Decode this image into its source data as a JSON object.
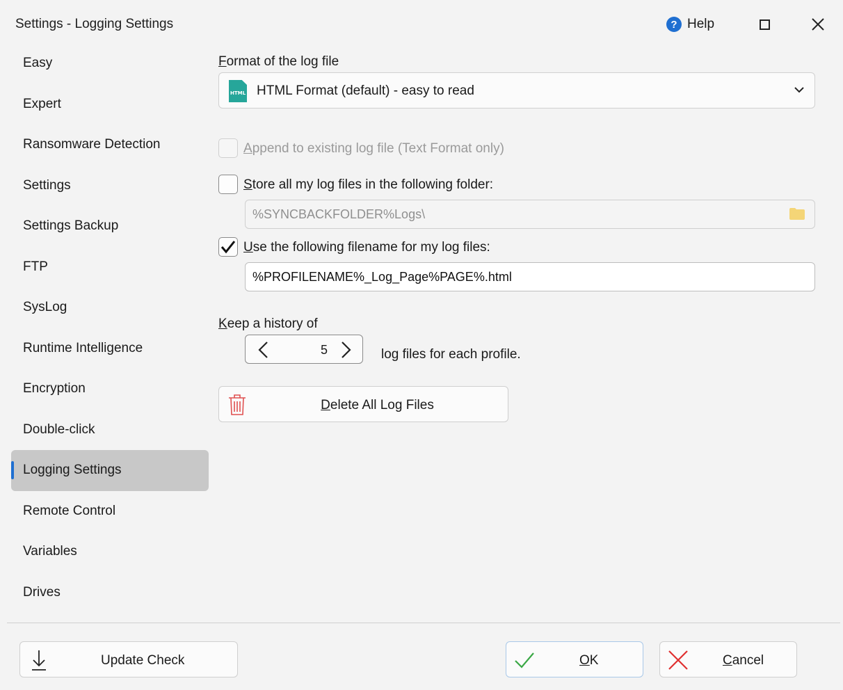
{
  "window": {
    "title": "Settings - Logging Settings",
    "help_label": "Help"
  },
  "sidebar": {
    "items": [
      {
        "label": "Easy"
      },
      {
        "label": "Expert"
      },
      {
        "label": "Ransomware Detection"
      },
      {
        "label": "Settings"
      },
      {
        "label": "Settings Backup"
      },
      {
        "label": "FTP"
      },
      {
        "label": "SysLog"
      },
      {
        "label": "Runtime Intelligence"
      },
      {
        "label": "Encryption"
      },
      {
        "label": "Double-click"
      },
      {
        "label": "Logging Settings",
        "active": true
      },
      {
        "label": "Remote Control"
      },
      {
        "label": "Variables"
      },
      {
        "label": "Drives"
      }
    ]
  },
  "logging": {
    "format_label_first": "F",
    "format_label_rest": "ormat of the log file",
    "format_value": "HTML Format (default) - easy to read",
    "format_icon_text": "HTML",
    "append": {
      "checked": false,
      "disabled": true,
      "label_first": "A",
      "label_rest": "ppend to existing log file (Text Format only)"
    },
    "store_folder": {
      "checked": false,
      "label_first": "S",
      "label_rest": "tore all my log files in the following folder:",
      "value": "%SYNCBACKFOLDER%Logs\\"
    },
    "filename": {
      "checked": true,
      "label_first": "U",
      "label_rest": "se the following filename for my log files:",
      "value": "%PROFILENAME%_Log_Page%PAGE%.html"
    },
    "history": {
      "label_first": "K",
      "label_rest": "eep a history of",
      "value": "5",
      "suffix": "log files for each profile."
    },
    "delete_button": {
      "label_first": "D",
      "label_rest": "elete All Log Files"
    }
  },
  "footer": {
    "update_label": "Update Check",
    "ok_first": "O",
    "ok_rest": "K",
    "cancel_first": "C",
    "cancel_rest": "ancel"
  },
  "colors": {
    "accent": "#1f6fd1",
    "delete_red": "#e05050",
    "ok_green": "#3aa845",
    "cancel_red": "#e03030",
    "html_icon": "#26a69a",
    "folder": "#f4d577"
  }
}
